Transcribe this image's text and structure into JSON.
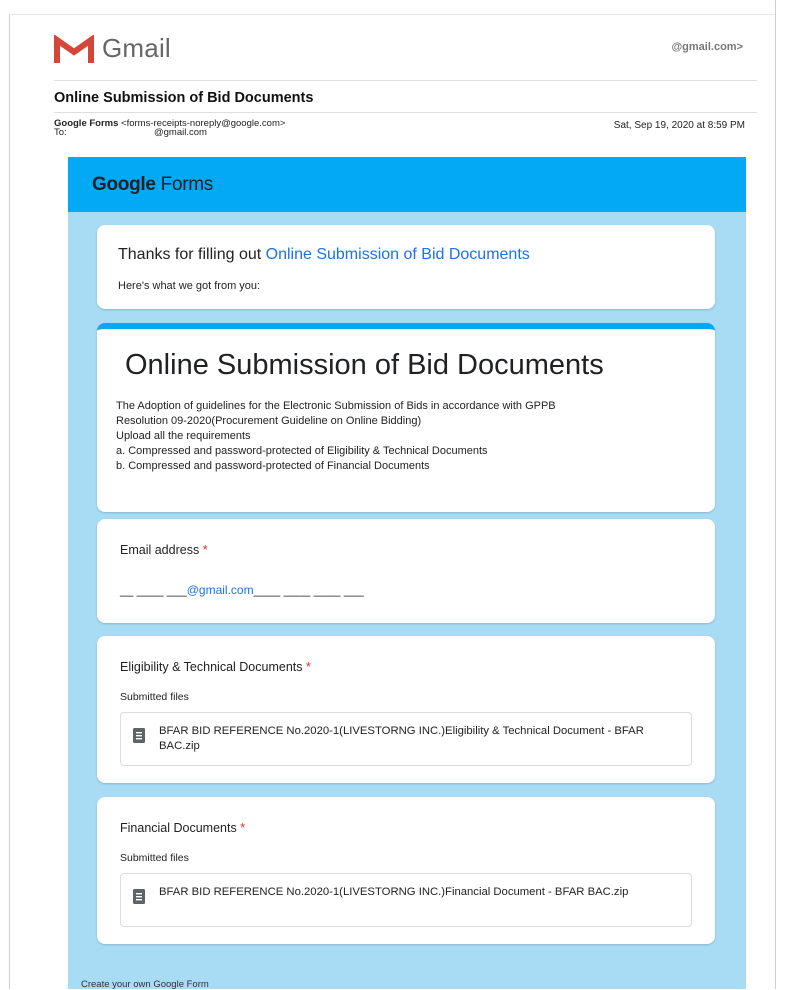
{
  "gmail": {
    "brand": "Gmail",
    "account": "@gmail.com>"
  },
  "message": {
    "subject": "Online Submission of Bid Documents",
    "from_name": "Google Forms",
    "from_email": "<forms-receipts-noreply@google.com>",
    "to_label": "To:",
    "to_value": "@gmail.com",
    "date": "Sat, Sep 19, 2020 at 8:59 PM"
  },
  "form_email": {
    "banner_logo_google": "Google",
    "banner_logo_forms": "Forms",
    "thanks_prefix": "Thanks for filling out",
    "thanks_form_link": "Online Submission of Bid Documents",
    "thanks_subtitle": "Here's what we got from you:",
    "form_title": "Online Submission of Bid Documents",
    "description_lines": [
      "The Adoption of guidelines for the Electronic Submission of Bids in accordance with GPPB",
      "Resolution 09-2020(Procurement Guideline on Online Bidding)",
      "Upload all the requirements",
      "a. Compressed and password-protected of Eligibility & Technical Documents",
      "b. Compressed and password-protected of Financial Documents"
    ],
    "questions": [
      {
        "label": "Email address",
        "required_mark": "*",
        "answer_prefix": "__ ____ ___",
        "answer_link": "@gmail.com",
        "answer_suffix": "____ ____ ____ ___"
      },
      {
        "label": "Eligibility & Technical Documents",
        "required_mark": "*",
        "submitted_label": "Submitted files",
        "file_name": "BFAR BID REFERENCE No.2020-1(LIVESTORNG INC.)Eligibility & Technical Document - BFAR BAC.zip"
      },
      {
        "label": "Financial Documents",
        "required_mark": "*",
        "submitted_label": "Submitted files",
        "file_name": "BFAR BID REFERENCE No.2020-1(LIVESTORNG INC.)Financial Document - BFAR BAC.zip"
      }
    ],
    "footer_link": "Create your own Google Form"
  },
  "icons": {
    "gmail_logo": "gmail-m-icon",
    "file": "archive-file-icon"
  },
  "colors": {
    "banner": "#03a9f4",
    "body_background": "#a8dcf5",
    "link": "#1a73e8",
    "required": "#d93025",
    "gmail_red": "#d44638"
  }
}
